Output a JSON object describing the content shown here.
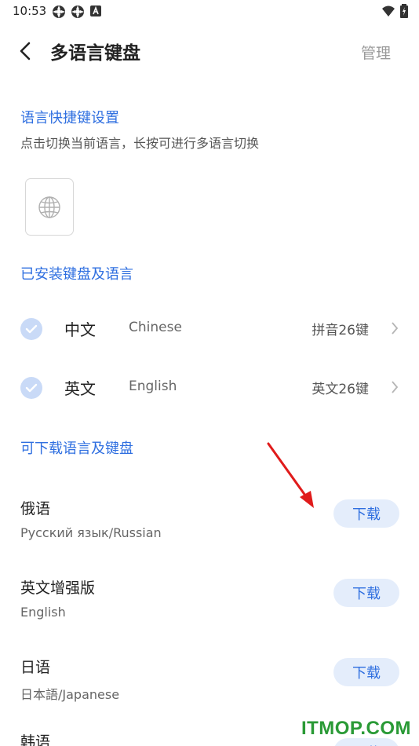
{
  "status": {
    "time": "10:53"
  },
  "header": {
    "title": "多语言键盘",
    "manage_label": "管理"
  },
  "shortcut": {
    "title": "语言快捷键设置",
    "hint": "点击切换当前语言，长按可进行多语言切换"
  },
  "installed": {
    "title": "已安装键盘及语言",
    "items": [
      {
        "zh": "中文",
        "en": "Chinese",
        "keyboard": "拼音26键"
      },
      {
        "zh": "英文",
        "en": "English",
        "keyboard": "英文26键"
      }
    ]
  },
  "downloadable": {
    "title": "可下载语言及键盘",
    "button_label": "下载",
    "items": [
      {
        "name": "俄语",
        "sub": "Русский язык/Russian"
      },
      {
        "name": "英文增强版",
        "sub": "English"
      },
      {
        "name": "日语",
        "sub": "日本語/Japanese"
      },
      {
        "name": "韩语",
        "sub": ""
      }
    ]
  },
  "watermark": "ITMOP.COM",
  "colors": {
    "accent": "#2f6fe0",
    "button_bg": "#e4edfb",
    "check_bg": "#c9daf7",
    "arrow": "#e01b1b"
  },
  "icons": [
    "settings-icon",
    "settings-icon",
    "a-icon",
    "wifi-icon",
    "battery-icon",
    "back-icon",
    "globe-icon",
    "check-icon",
    "chevron-right-icon"
  ]
}
